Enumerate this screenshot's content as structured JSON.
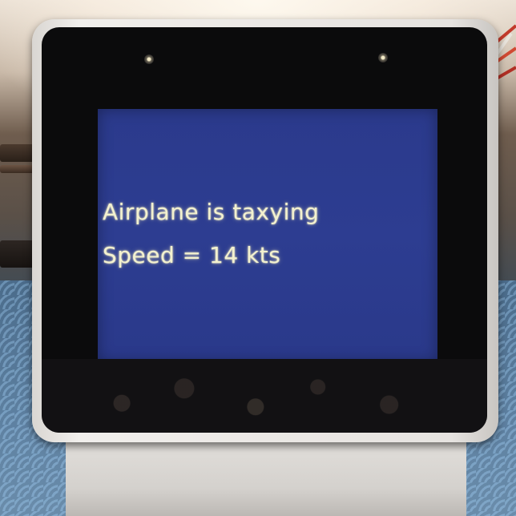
{
  "display": {
    "status_line": "Airplane is taxying",
    "speed_line": "Speed = 14 kts"
  },
  "colors": {
    "screen_background": "#2d3d91",
    "text": "#f3f1cf",
    "bezel": "#0b0b0c",
    "case": "#ebe8e5"
  }
}
